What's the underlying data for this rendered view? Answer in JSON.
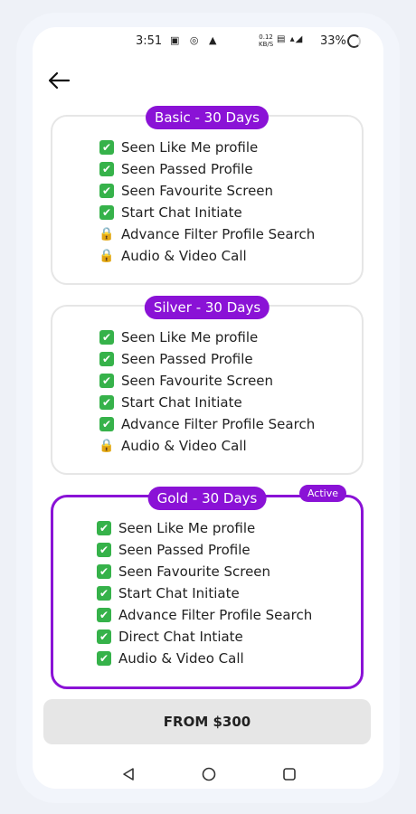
{
  "status_bar": {
    "time": "3:51",
    "left_icons": [
      "notification-icon",
      "sync-icon",
      "alarm-icon"
    ],
    "speed_value": "0.12",
    "speed_unit": "KB/S",
    "net": "VoLTE 4G",
    "battery": "33%"
  },
  "header": {
    "back_icon": "back-arrow-icon"
  },
  "plans": [
    {
      "title": "Basic - 30 Days",
      "active": false,
      "features": [
        {
          "text": "Seen Like Me profile",
          "status": "check"
        },
        {
          "text": "Seen Passed Profile",
          "status": "check"
        },
        {
          "text": "Seen Favourite Screen",
          "status": "check"
        },
        {
          "text": "Start Chat Initiate",
          "status": "check"
        },
        {
          "text": "Advance Filter Profile Search",
          "status": "lock"
        },
        {
          "text": "Audio & Video Call",
          "status": "lock"
        }
      ]
    },
    {
      "title": "Silver - 30 Days",
      "active": false,
      "features": [
        {
          "text": "Seen Like Me profile",
          "status": "check"
        },
        {
          "text": "Seen Passed Profile",
          "status": "check"
        },
        {
          "text": "Seen Favourite Screen",
          "status": "check"
        },
        {
          "text": "Start Chat Initiate",
          "status": "check"
        },
        {
          "text": "Advance Filter Profile Search",
          "status": "check"
        },
        {
          "text": "Audio & Video Call",
          "status": "lock"
        }
      ]
    },
    {
      "title": "Gold - 30 Days",
      "active": true,
      "badge": "Active",
      "features": [
        {
          "text": "Seen Like Me profile",
          "status": "check"
        },
        {
          "text": "Seen Passed Profile",
          "status": "check"
        },
        {
          "text": "Seen Favourite Screen",
          "status": "check"
        },
        {
          "text": "Start Chat Initiate",
          "status": "check"
        },
        {
          "text": "Advance Filter Profile Search",
          "status": "check"
        },
        {
          "text": "Direct Chat Intiate",
          "status": "check"
        },
        {
          "text": "Audio & Video Call",
          "status": "check"
        }
      ]
    }
  ],
  "cta": {
    "label": "FROM $300"
  },
  "colors": {
    "accent": "#8a12d6",
    "check": "#36b24a",
    "lock": "#d6a21a"
  },
  "nav": {
    "back": "nav-back-icon",
    "home": "nav-home-icon",
    "recents": "nav-recents-icon"
  }
}
